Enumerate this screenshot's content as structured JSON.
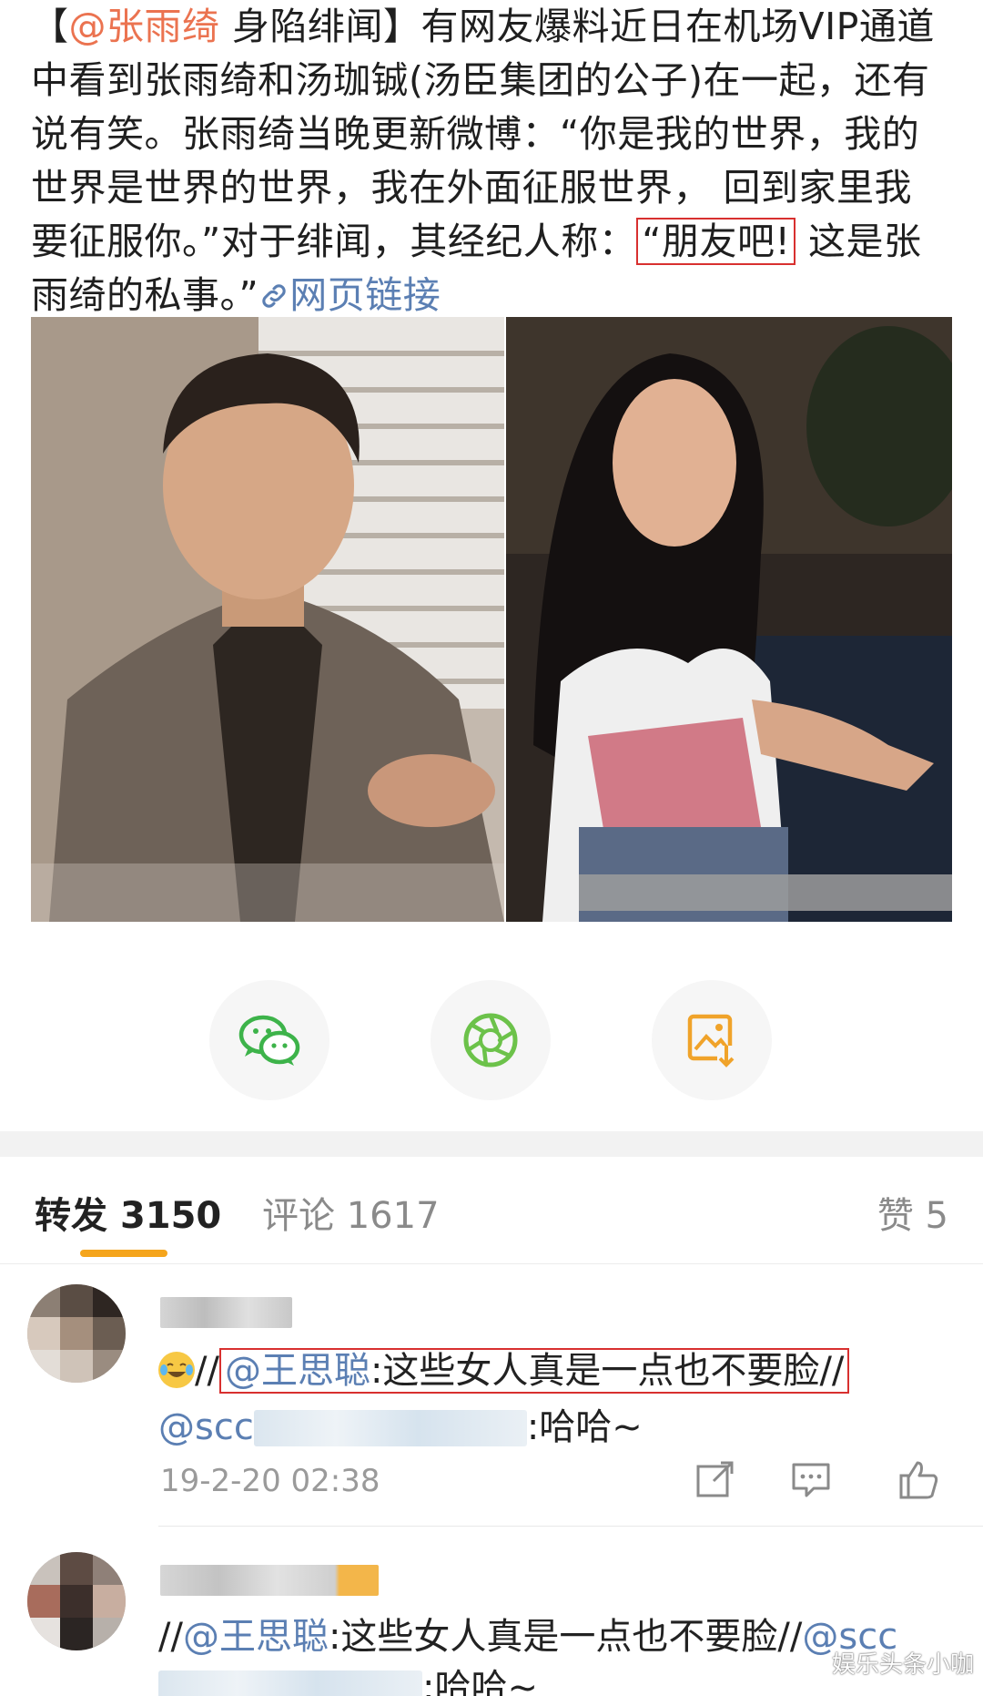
{
  "post": {
    "lines": [
      {
        "pre": "【",
        "mention": "@张雨绮",
        "rest": " 身陷绯闻】有网友爆料近日在机场VIP通道"
      },
      {
        "text": "中看到张雨绮和汤珈铖(汤臣集团的公子)在一起，还有"
      },
      {
        "text": "说有笑。张雨绮当晚更新微博：“你是我的世界，我的"
      },
      {
        "text": "世界是世界的世界，我在外面征服世界， 回到家里我"
      },
      {
        "pre": "要征服你。”对于绯闻，其经纪人称：",
        "highlight": "“朋友吧!",
        "rest": " 这是张"
      },
      {
        "pre": "雨绮的私事。”",
        "link": "网页链接"
      }
    ]
  },
  "share_buttons": [
    {
      "icon": "wechat-icon",
      "color": "#3db34a"
    },
    {
      "icon": "moments-icon",
      "color": "#6cc24a"
    },
    {
      "icon": "save-image-icon",
      "color": "#f0a32a"
    }
  ],
  "tabs": {
    "repost": {
      "label": "转发",
      "count": "3150"
    },
    "comments": {
      "label": "评论",
      "count": "1617"
    },
    "likes": {
      "label": "赞",
      "count": "5"
    }
  },
  "reposts": [
    {
      "text_a": "//",
      "mention1": "@王思聪",
      "text_b": ":这些女人真是一点也不要脸",
      "text_c": "//",
      "mention2": "@scc",
      "text_d": ":哈哈~",
      "time": "19-2-20 02:38"
    },
    {
      "text_a": "//",
      "mention1": "@王思聪",
      "text_b": ":这些女人真是一点也不要脸//",
      "mention2": "@scc",
      "text_d": ":哈哈~"
    }
  ],
  "watermark": "娱乐头条小咖"
}
